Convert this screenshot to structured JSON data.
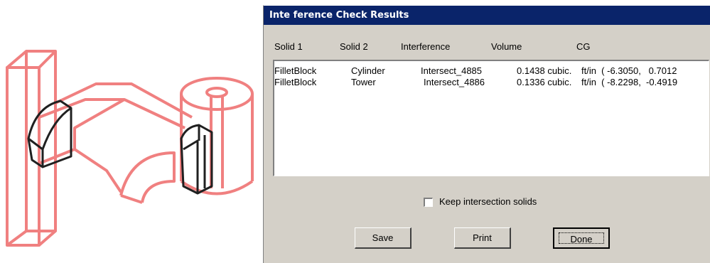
{
  "dialog": {
    "title": "Inte ference Check Results",
    "columns": [
      "Solid 1",
      "Solid 2",
      "Interference",
      "Volume",
      "CG"
    ],
    "rows": [
      {
        "solid1": "FilletBlock",
        "solid2": "Cylinder",
        "interference": "Intersect_4885",
        "volume": "0.1438 cubic.",
        "cg": "ft/in  ( -6.3050,   0.7012"
      },
      {
        "solid1": "FilletBlock",
        "solid2": "Tower",
        "interference": "Intersect_4886",
        "volume": "0.1336 cubic.",
        "cg": "ft/in  ( -8.2298,  -0.4919"
      }
    ],
    "keep_label": "Keep intersection solids",
    "keep_checked": false,
    "buttons": {
      "save": "Save",
      "print": "Print",
      "done": "Done"
    }
  },
  "colors": {
    "wireframe_red": "#f08080",
    "wireframe_dark": "#202020",
    "titlebar": "#0a246a"
  }
}
